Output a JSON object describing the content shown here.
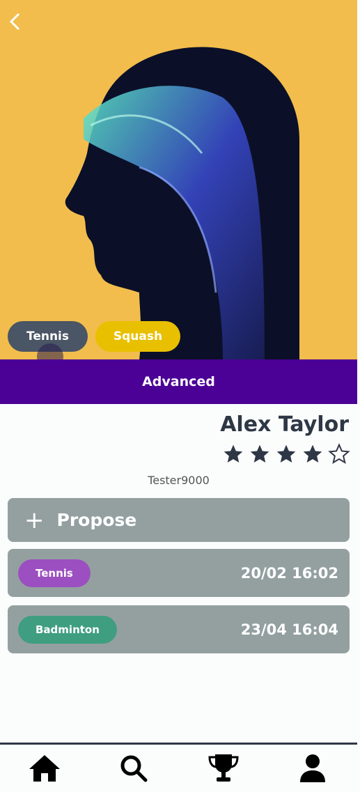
{
  "profile": {
    "sports": [
      {
        "label": "Tennis",
        "color": "#4a5565"
      },
      {
        "label": "Squash",
        "color": "#e8c000"
      }
    ],
    "level": "Advanced",
    "name": "Alex Taylor",
    "rating": 4,
    "rating_max": 5,
    "username": "Tester9000"
  },
  "actions": {
    "propose_label": "Propose",
    "propose_icon": "plus-icon"
  },
  "matches": [
    {
      "sport": "Tennis",
      "color": "#9b4fc0",
      "datetime": "20/02 16:02"
    },
    {
      "sport": "Badminton",
      "color": "#3f9e80",
      "datetime": "23/04 16:04"
    }
  ],
  "nav": [
    {
      "icon": "home-icon"
    },
    {
      "icon": "search-icon"
    },
    {
      "icon": "trophy-icon"
    },
    {
      "icon": "profile-icon"
    }
  ],
  "colors": {
    "accent": "#4b0096",
    "card": "#94a0a0",
    "text": "#2e3745"
  }
}
